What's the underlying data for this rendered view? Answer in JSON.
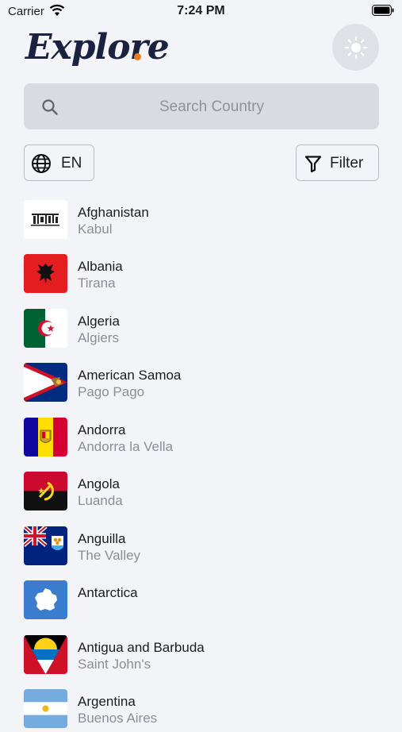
{
  "status_bar": {
    "carrier": "Carrier",
    "time": "7:24 PM"
  },
  "header": {
    "title": "Explore"
  },
  "search": {
    "placeholder": "Search Country"
  },
  "language_button": {
    "label": "EN"
  },
  "filter_button": {
    "label": "Filter"
  },
  "countries": [
    {
      "name": "Afghanistan",
      "capital": "Kabul",
      "flag_icon": "afghanistan-flag"
    },
    {
      "name": "Albania",
      "capital": "Tirana",
      "flag_icon": "albania-flag"
    },
    {
      "name": "Algeria",
      "capital": "Algiers",
      "flag_icon": "algeria-flag"
    },
    {
      "name": "American Samoa",
      "capital": "Pago Pago",
      "flag_icon": "american-samoa-flag"
    },
    {
      "name": "Andorra",
      "capital": "Andorra la Vella",
      "flag_icon": "andorra-flag"
    },
    {
      "name": "Angola",
      "capital": "Luanda",
      "flag_icon": "angola-flag"
    },
    {
      "name": "Anguilla",
      "capital": "The Valley",
      "flag_icon": "anguilla-flag"
    },
    {
      "name": "Antarctica",
      "capital": "",
      "flag_icon": "antarctica-flag"
    },
    {
      "name": "Antigua and Barbuda",
      "capital": "Saint John's",
      "flag_icon": "antigua-and-barbuda-flag"
    },
    {
      "name": "Argentina",
      "capital": "Buenos Aires",
      "flag_icon": "argentina-flag"
    }
  ],
  "colors": {
    "accent_dot": "#f07a1c",
    "title": "#1b2240",
    "background": "#f2f4f7"
  }
}
